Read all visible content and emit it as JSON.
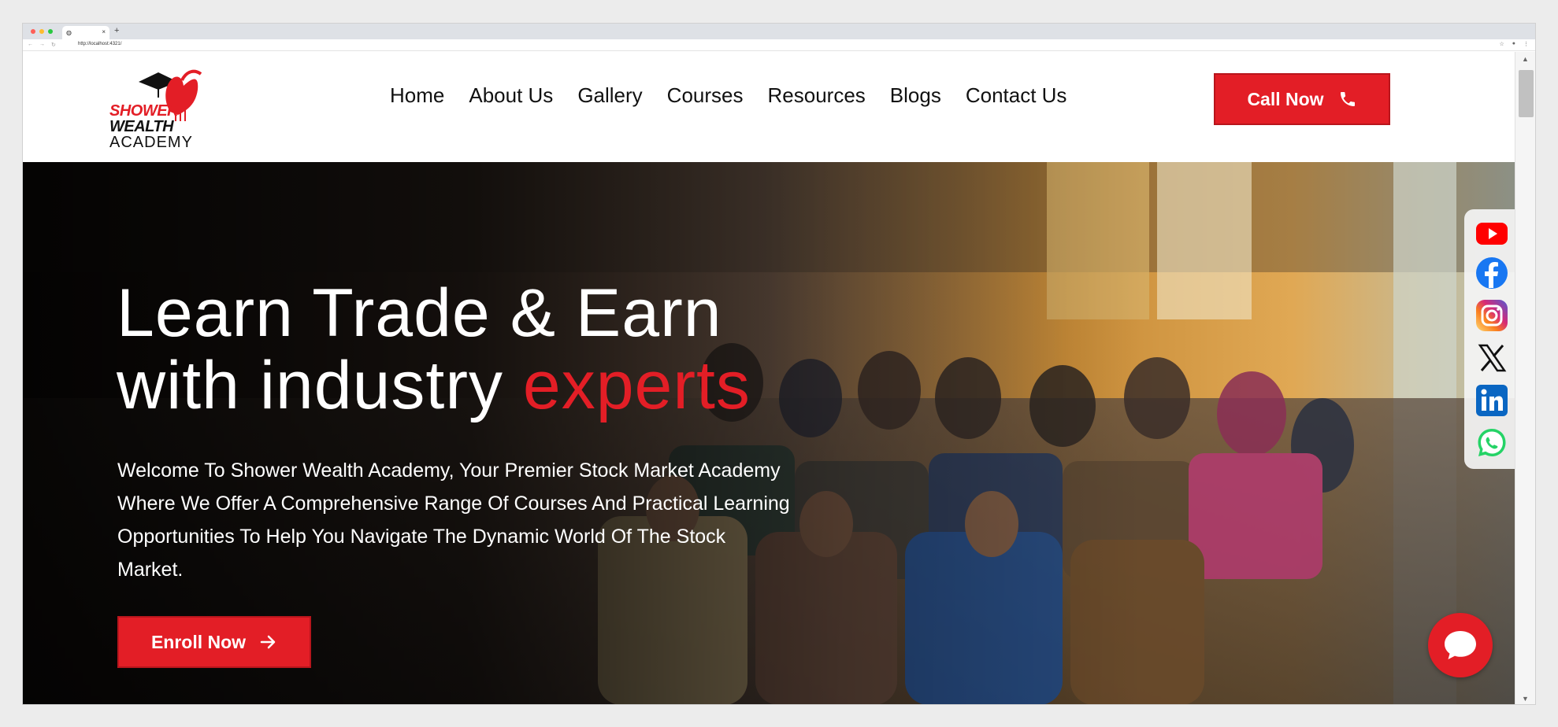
{
  "browser": {
    "tab_title": "",
    "tab_close": "×",
    "new_tab": "+",
    "url": "http://localhost:4321/"
  },
  "header": {
    "logo": {
      "line1": "SHOWER",
      "line2": "WEALTH",
      "line3": "ACADEMY"
    },
    "nav": [
      "Home",
      "About Us",
      "Gallery",
      "Courses",
      "Resources",
      "Blogs",
      "Contact Us"
    ],
    "call_button": "Call Now",
    "call_icon": "phone-icon"
  },
  "hero": {
    "title_line1": "Learn Trade & Earn",
    "title_line2_plain": "with industry ",
    "title_line2_accent": "experts",
    "description": "Welcome To Shower Wealth Academy, Your Premier Stock Market Academy Where We Offer A Comprehensive Range Of Courses And Practical Learning Opportunities To Help You Navigate The Dynamic World Of The Stock Market.",
    "enroll_button": "Enroll Now",
    "enroll_icon": "arrow-right-icon"
  },
  "social": {
    "icons": [
      "youtube-icon",
      "facebook-icon",
      "instagram-icon",
      "x-icon",
      "linkedin-icon",
      "whatsapp-icon"
    ]
  },
  "chat": {
    "icon": "chat-icon"
  },
  "colors": {
    "accent": "#e31e26",
    "text_dark": "#111111",
    "white": "#ffffff"
  }
}
